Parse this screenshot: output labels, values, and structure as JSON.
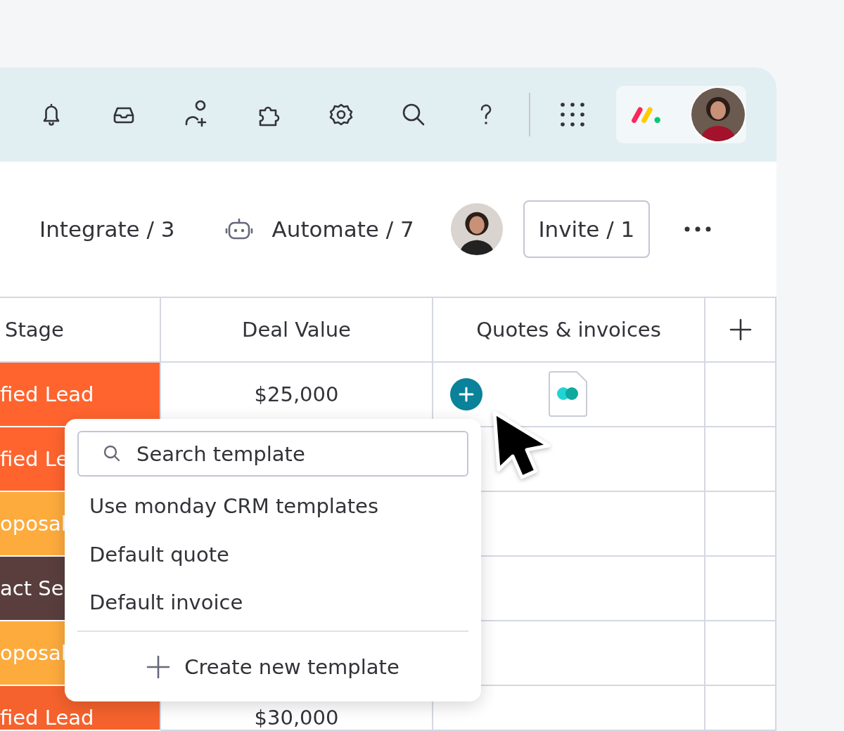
{
  "toolbar": {
    "integrate": "Integrate / 3",
    "automate": "Automate / 7",
    "invite": "Invite / 1"
  },
  "table": {
    "columns": [
      "Stage",
      "Deal Value",
      "Quotes & invoices"
    ],
    "rows": [
      {
        "stage": "fied Lead",
        "color": "#ff642e",
        "deal_value": "$25,000"
      },
      {
        "stage": "fied Le",
        "color": "#ff642e"
      },
      {
        "stage": "oposal",
        "color": "#fdab3d"
      },
      {
        "stage": "act Se",
        "color": "#5a3e3e"
      },
      {
        "stage": "oposal",
        "color": "#fdab3d"
      },
      {
        "stage": "fied Lead",
        "color": "#f5622d",
        "deal_value": "$30,000"
      }
    ]
  },
  "template_menu": {
    "search": {
      "placeholder": "Search template"
    },
    "items": [
      "Use monday CRM templates",
      "Default quote",
      "Default invoice"
    ],
    "create": "Create new template"
  }
}
